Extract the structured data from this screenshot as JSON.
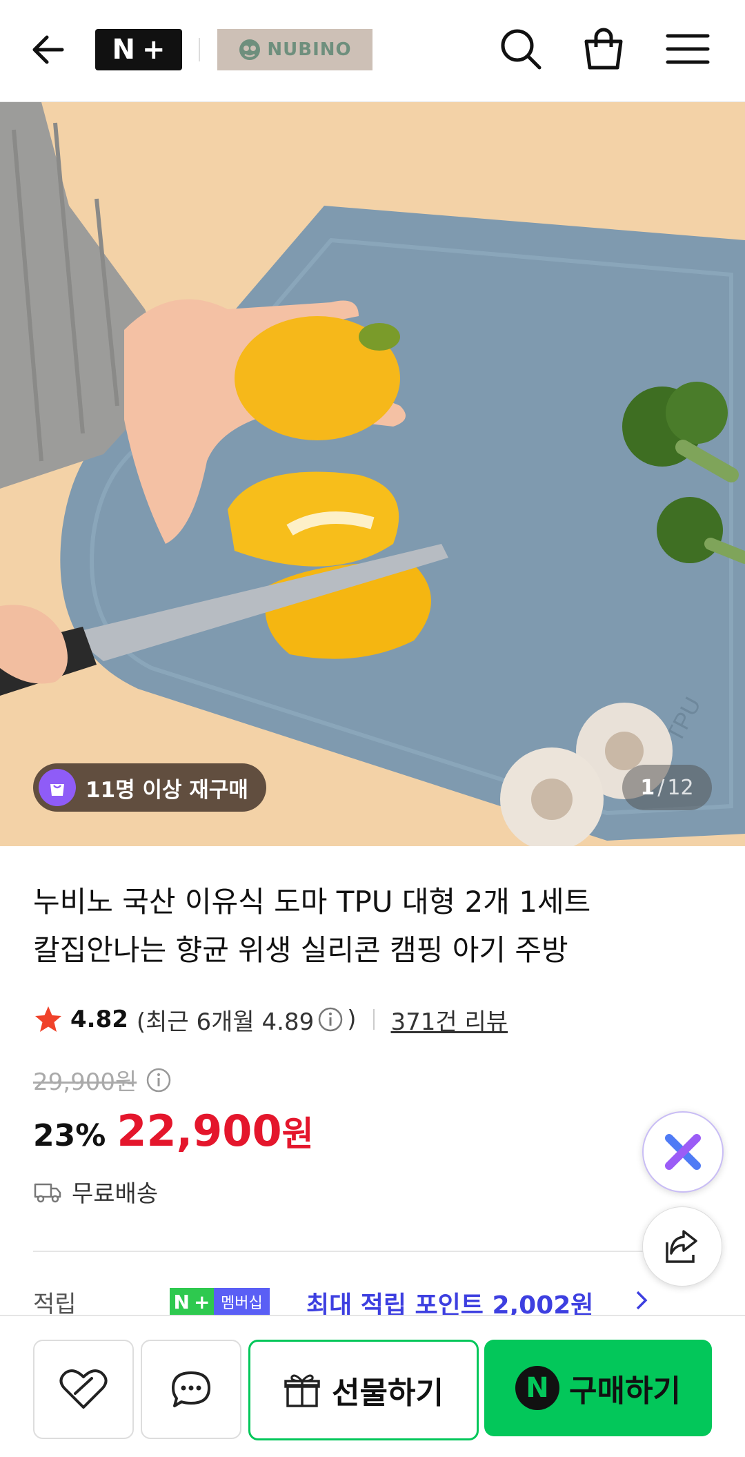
{
  "header": {
    "nplus_letters": [
      "N",
      "+"
    ],
    "brand_name": "NUBINO",
    "icons": [
      "back-arrow-icon",
      "search-icon",
      "shopping-bag-icon",
      "hamburger-menu-icon"
    ]
  },
  "gallery": {
    "badge_text": "11명 이상 재구매",
    "current": "1",
    "total": "12",
    "slash": "/",
    "board_mark": "TPU"
  },
  "product": {
    "title_line1": "누비노 국산 이유식 도마 TPU 대형 2개 1세트",
    "title_line2": "칼집안나는 향균 위생 실리콘 캠핑 아기 주방",
    "rating": "4.82",
    "recent_rating": "(최근 6개월 4.89",
    "recent_close": ")",
    "review_count": "371건 리뷰",
    "original_price": "29,900원",
    "discount": "23%",
    "price": "22,900",
    "currency": "원",
    "shipping": "무료배송"
  },
  "points": {
    "label": "적립",
    "member_n": "N",
    "member_plus": "+",
    "member_label": "멤버십",
    "text": "최대 적립 포인트 2,002원"
  },
  "actions": {
    "gift_label": "선물하기",
    "buy_badge": "N",
    "buy_label": "구매하기"
  },
  "colors": {
    "accent_green": "#03c75a",
    "price_red": "#e4162c",
    "points_blue": "#3d3fe0",
    "star": "#f0422a",
    "badge_purple": "#8f5cf7"
  }
}
